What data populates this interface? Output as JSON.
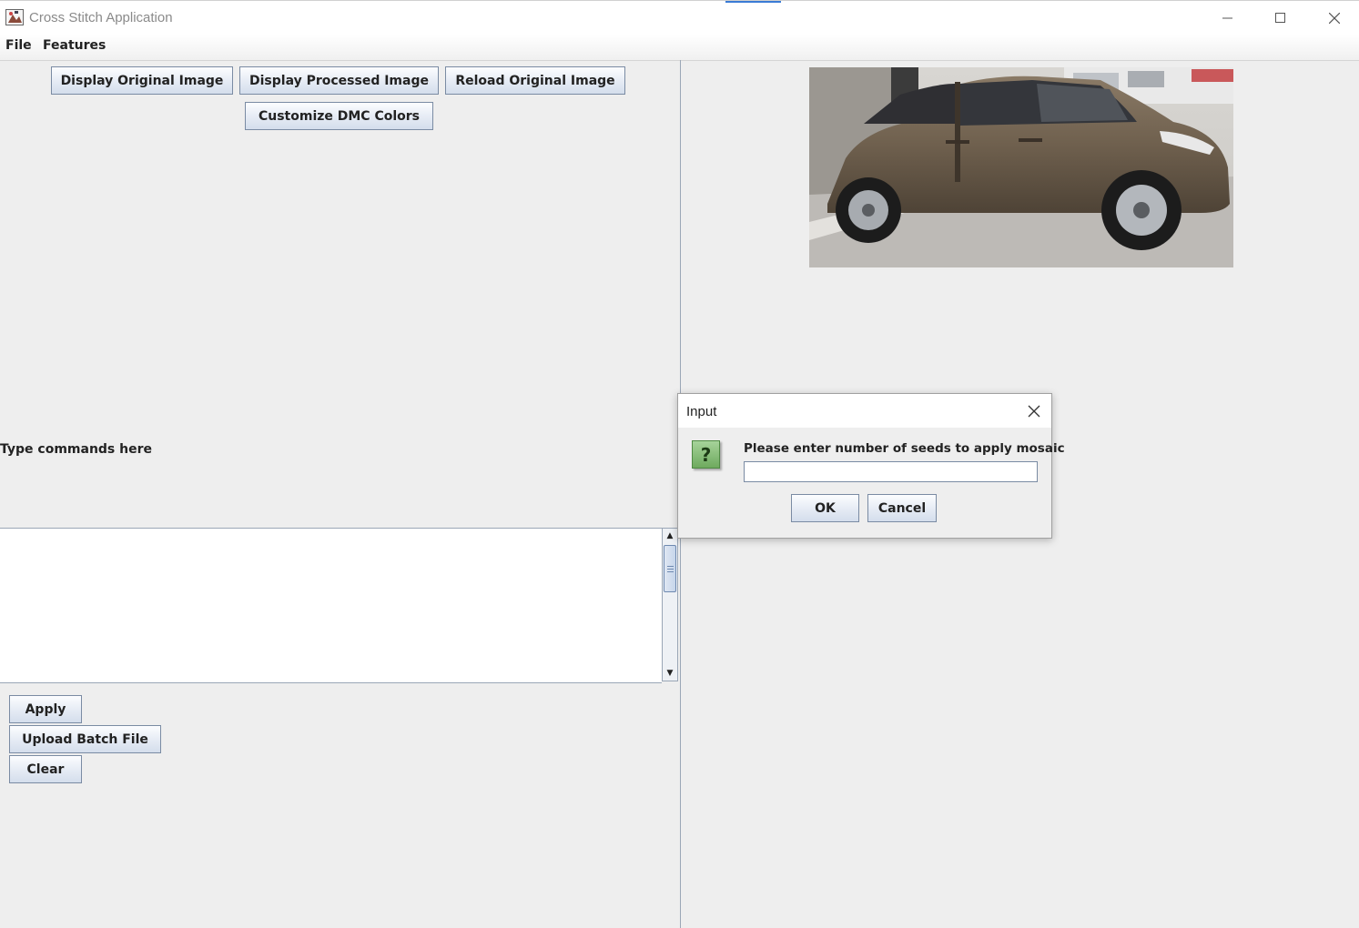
{
  "window": {
    "title": "Cross Stitch Application"
  },
  "menu": {
    "file": "File",
    "features": "Features"
  },
  "toolbar": {
    "display_original": "Display Original Image",
    "display_processed": "Display Processed Image",
    "reload_original": "Reload Original Image",
    "customize_dmc": "Customize DMC Colors"
  },
  "commands": {
    "label": "Type commands here",
    "text": ""
  },
  "actions": {
    "apply": "Apply",
    "upload_batch": "Upload Batch File",
    "clear": "Clear"
  },
  "dialog": {
    "title": "Input",
    "icon": "question-icon",
    "message": "Please enter number of seeds to apply mosaic",
    "input_value": "",
    "ok": "OK",
    "cancel": "Cancel"
  },
  "colors": {
    "button_border": "#7a8ba3",
    "background": "#eeeeee",
    "question_icon": "#7fb96f"
  }
}
